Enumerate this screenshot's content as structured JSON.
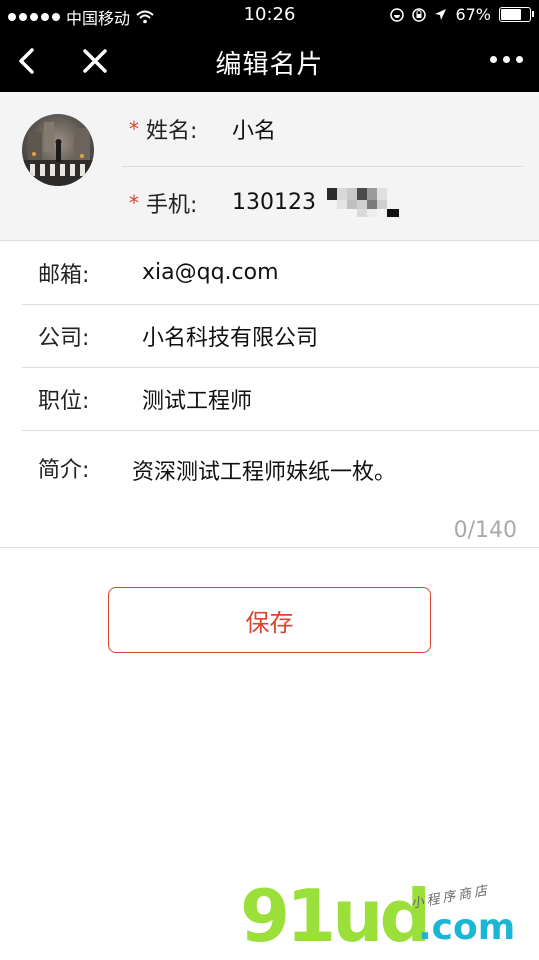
{
  "status": {
    "carrier": "中国移动",
    "time": "10:26",
    "battery": "67%"
  },
  "nav": {
    "title": "编辑名片"
  },
  "profile": {
    "name_label": "姓名:",
    "name_value": "小名",
    "phone_label": "手机:",
    "phone_value": "130123",
    "required_mark": "*"
  },
  "form": {
    "email_label": "邮箱:",
    "email_value": "xia@qq.com",
    "company_label": "公司:",
    "company_value": "小名科技有限公司",
    "position_label": "职位:",
    "position_value": "测试工程师",
    "intro_label": "简介:",
    "intro_value": "资深测试工程师妹纸一枚。",
    "intro_count": "0/140"
  },
  "actions": {
    "save_label": "保存"
  },
  "watermark": {
    "brand": "91ud",
    "domain": ".com",
    "tagline": "小程序商店"
  }
}
